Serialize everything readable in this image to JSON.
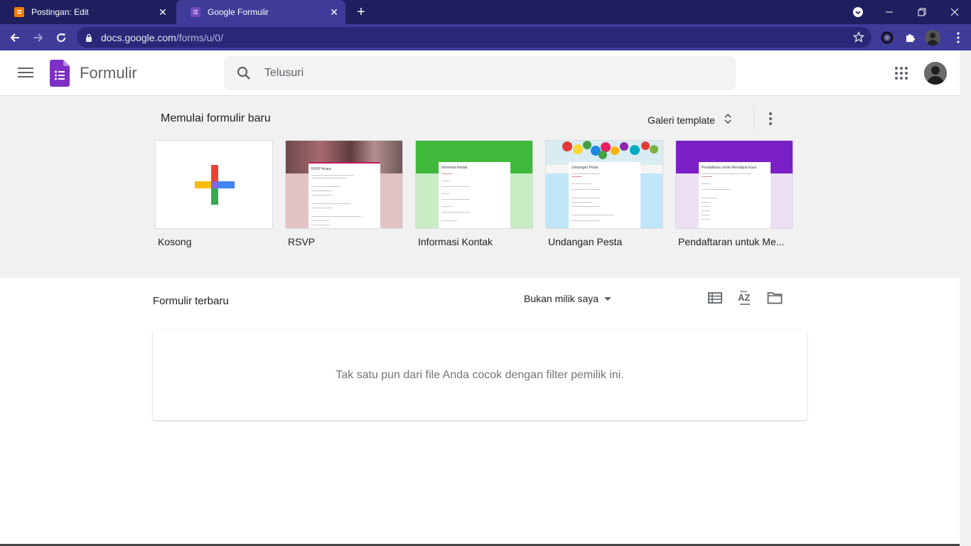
{
  "browser": {
    "tabs": [
      {
        "title": "Postingan: Edit",
        "active": false
      },
      {
        "title": "Google Formulir",
        "active": true
      }
    ],
    "url_host": "docs.google.com",
    "url_path": "/forms/u/0/"
  },
  "header": {
    "brand": "Formulir",
    "search_placeholder": "Telusuri"
  },
  "gallery": {
    "title": "Memulai formulir baru",
    "gallery_button": "Galeri template",
    "templates": [
      {
        "label": "Kosong"
      },
      {
        "label": "RSVP",
        "mini_title": "RSVP Acara"
      },
      {
        "label": "Informasi Kontak",
        "mini_title": "Informasi kontak"
      },
      {
        "label": "Undangan Pesta",
        "mini_title": "Undangan Pesta"
      },
      {
        "label": "Pendaftaran untuk Me...",
        "mini_title": "Pendaftaran untuk Mendapat Kaos"
      }
    ]
  },
  "recent": {
    "title": "Formulir terbaru",
    "owner_filter": "Bukan milik saya",
    "empty_message": "Tak satu pun dari file Anda cocok dengan filter pemilik ini."
  },
  "colors": {
    "tabbar": "#1f1e5f",
    "toolbar": "#3f3b99",
    "forms_purple": "#7248b9",
    "gallery_bg": "#f1f1f1"
  },
  "icons": [
    "blogger-icon",
    "forms-icon",
    "close-icon",
    "plus-icon",
    "back-icon",
    "forward-icon",
    "reload-icon",
    "lock-icon",
    "star-icon",
    "extension-icon",
    "menu-icon",
    "search-icon",
    "apps-icon",
    "sort-icon",
    "more-vert-icon",
    "list-view-icon",
    "sort-az-icon",
    "folder-icon"
  ]
}
